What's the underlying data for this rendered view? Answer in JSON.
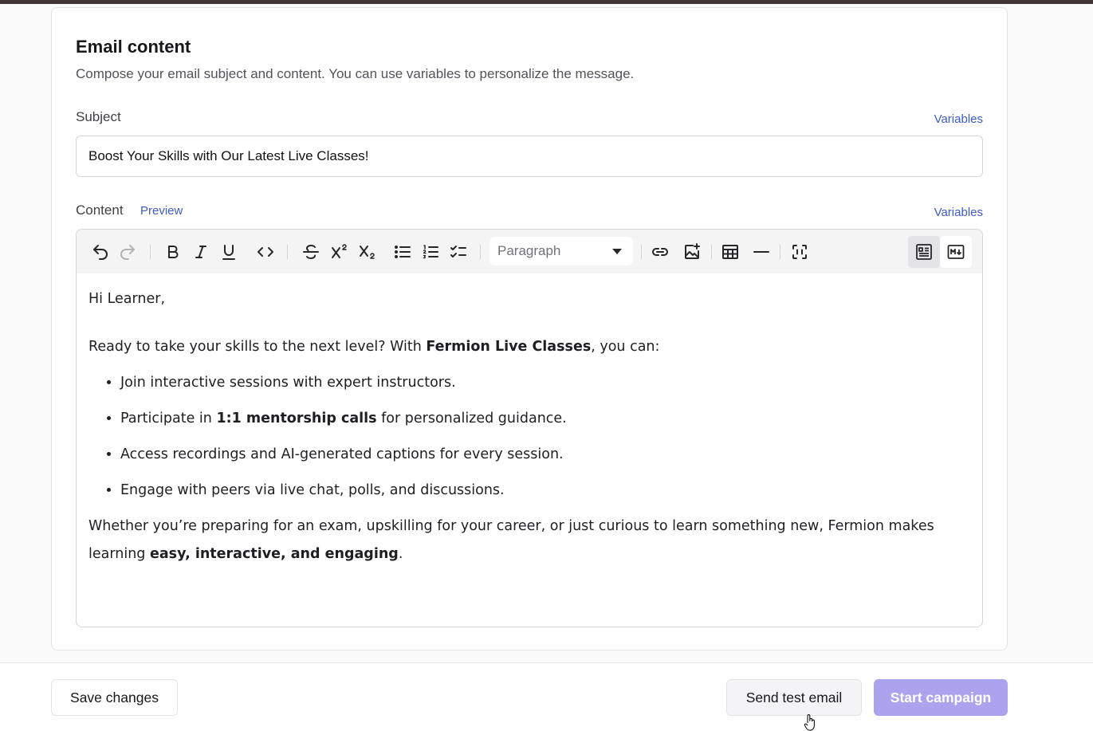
{
  "section": {
    "title": "Email content",
    "description": "Compose your email subject and content. You can use variables to personalize the message."
  },
  "subject": {
    "label": "Subject",
    "variables_link": "Variables",
    "value": "Boost Your Skills with Our Latest Live Classes!"
  },
  "content": {
    "label": "Content",
    "preview_link": "Preview",
    "variables_link": "Variables"
  },
  "toolbar": {
    "block_type": "Paragraph",
    "icons": [
      "undo-icon",
      "redo-icon",
      "bold-icon",
      "italic-icon",
      "underline-icon",
      "code-icon",
      "strikethrough-icon",
      "superscript-icon",
      "subscript-icon",
      "bullet-list-icon",
      "ordered-list-icon",
      "task-list-icon",
      "link-icon",
      "image-icon",
      "table-icon",
      "horizontal-rule-icon",
      "fullscreen-icon",
      "rich-text-mode-icon",
      "markdown-mode-icon"
    ]
  },
  "body": {
    "greeting": "Hi Learner,",
    "intro_before": "Ready to take your skills to the next level? With ",
    "intro_bold": "Fermion Live Classes",
    "intro_after": ", you can:",
    "bullet1": "Join interactive sessions with expert instructors.",
    "bullet2_before": "Participate in ",
    "bullet2_bold": "1:1 mentorship calls",
    "bullet2_after": " for personalized guidance.",
    "bullet3": "Access recordings and AI-generated captions for every session.",
    "bullet4": "Engage with peers via live chat, polls, and discussions.",
    "closing_before": "Whether you’re preparing for an exam, upskilling for your career, or just curious to learn something new, Fermion makes learning ",
    "closing_bold": "easy, interactive, and engaging",
    "closing_after": "."
  },
  "footer": {
    "save_label": "Save changes",
    "test_label": "Send test email",
    "start_label": "Start campaign"
  },
  "colors": {
    "accent_link": "#3b5bd0",
    "primary_disabled": "#aba3ee",
    "topbar": "#3f3534"
  }
}
